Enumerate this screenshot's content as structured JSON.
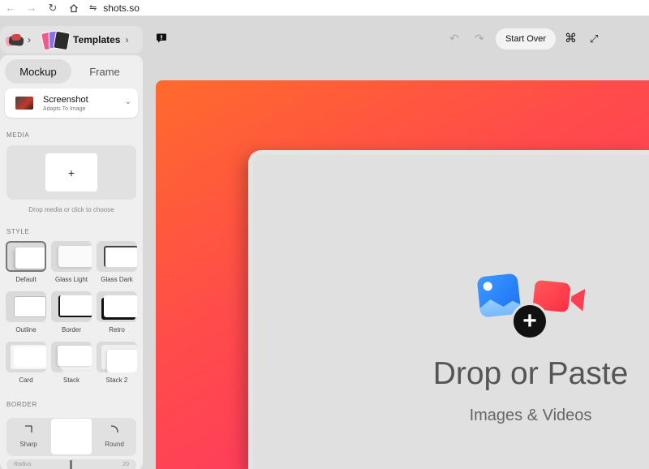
{
  "browser": {
    "url": "shots.so"
  },
  "header": {
    "templates_label": "Templates"
  },
  "tabs": [
    {
      "label": "Mockup",
      "active": true
    },
    {
      "label": "Frame",
      "active": false
    }
  ],
  "mockup": {
    "title": "Screenshot",
    "subtitle": "Adapts To Image"
  },
  "media": {
    "section_label": "MEDIA",
    "add_symbol": "+",
    "hint": "Drop media or click to choose"
  },
  "style": {
    "section_label": "STYLE",
    "options": [
      {
        "label": "Default",
        "selected": true
      },
      {
        "label": "Glass Light",
        "selected": false
      },
      {
        "label": "Glass Dark",
        "selected": false
      },
      {
        "label": "Outline",
        "selected": false
      },
      {
        "label": "Border",
        "selected": false
      },
      {
        "label": "Retro",
        "selected": false
      },
      {
        "label": "Card",
        "selected": false
      },
      {
        "label": "Stack",
        "selected": false
      },
      {
        "label": "Stack 2",
        "selected": false
      }
    ]
  },
  "border": {
    "section_label": "BORDER",
    "sharp_label": "Sharp",
    "round_label": "Round",
    "radius_label": "Radius",
    "radius_value": "20"
  },
  "toolbar": {
    "start_over_label": "Start Over",
    "cmd_symbol": "⌘",
    "expand_symbol": "⤢"
  },
  "canvas": {
    "drop_title": "Drop or Paste",
    "drop_subtitle": "Images & Videos",
    "plus_symbol": "+"
  },
  "colors": {
    "gradient_start": "#ff6a2c",
    "gradient_end": "#ff2d6e",
    "photo_icon": "#2f86ff",
    "video_icon": "#ff3f52"
  }
}
